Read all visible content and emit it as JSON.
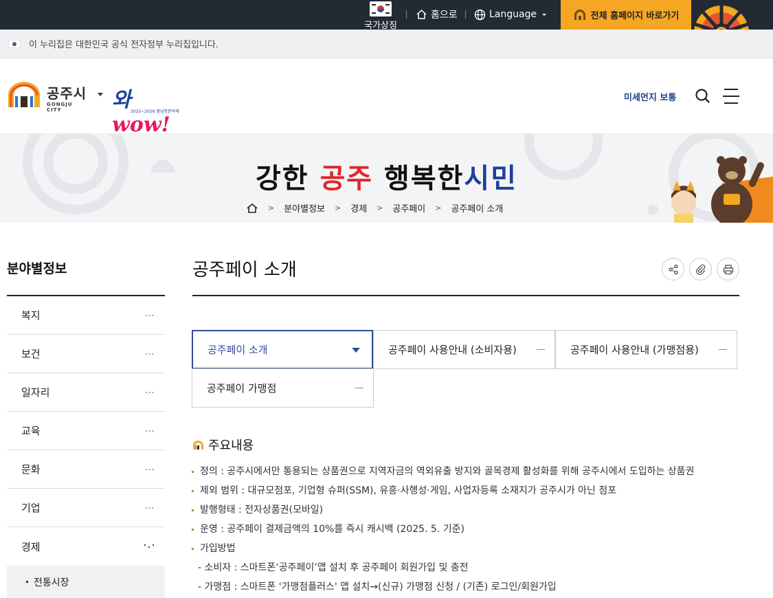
{
  "topbar": {
    "national_symbol": "국가상징",
    "home": "홈으로",
    "language": "Language",
    "full_homepage": "전체 홈페이지 바로가기"
  },
  "gov_banner": "이 누리집은 대한민국 공식 전자정부 누리집입니다.",
  "header": {
    "logo_main": "공주시",
    "logo_sub": "GONGJU CITY",
    "wow_main_a": "와",
    "wow_main_b": "wow!",
    "wow_sub": "2025~2026 충남방문의해",
    "dust": "미세먼지 보통"
  },
  "visual": {
    "slogan_1": "강한 ",
    "slogan_2": "공주",
    "slogan_3": " 행복한",
    "slogan_4": "시민",
    "breadcrumb": [
      "분야별정보",
      "경제",
      "공주페이",
      "공주페이 소개"
    ]
  },
  "lnb": {
    "title": "분야별정보",
    "items": [
      "복지",
      "보건",
      "일자리",
      "교육",
      "문화",
      "기업",
      "경제"
    ],
    "sub_item": "전통시장"
  },
  "content": {
    "title": "공주페이 소개",
    "tabs": [
      "공주페이 소개",
      "공주페이 사용안내 (소비자용)",
      "공주페이 사용안내 (가맹점용)",
      "공주페이 가맹점"
    ],
    "section_title": "주요내용",
    "lines": [
      "정의 : 공주시에서만 통용되는 상품권으로 지역자금의 역외유출 방지와 골목경제 활성화를 위해 공주시에서 도입하는 상품권",
      "제외 범위 : 대규모점포, 기업형 슈퍼(SSM), 유흥·사행성·게임, 사업자등록 소재지가 공주시가 아닌 점포",
      "발행형태 : 전자상품권(모바일)",
      "운영 : 공주페이 결제금액의 10%를 즉시 캐시백 (2025. 5. 기준)",
      "가입방법",
      "- 소비자 : 스마트폰‘공주페이’앱 설치 후 공주페이 회원가입 및 충전",
      "- 가맹점 : 스마트폰 '가맹점플러스' 앱 설치→(신규) 가맹점 신청 / (기존) 로그인/회원가입"
    ]
  },
  "colors": {
    "topbar_bg": "#222a33",
    "accent_orange": "#f5a623",
    "brand_navy": "#1f3f87",
    "active_tab": "#2f4b9a"
  },
  "icons": [
    "home-icon",
    "globe-icon",
    "gongju-arch-icon",
    "search-icon",
    "menu-icon",
    "share-icon",
    "clip-icon",
    "print-icon"
  ]
}
